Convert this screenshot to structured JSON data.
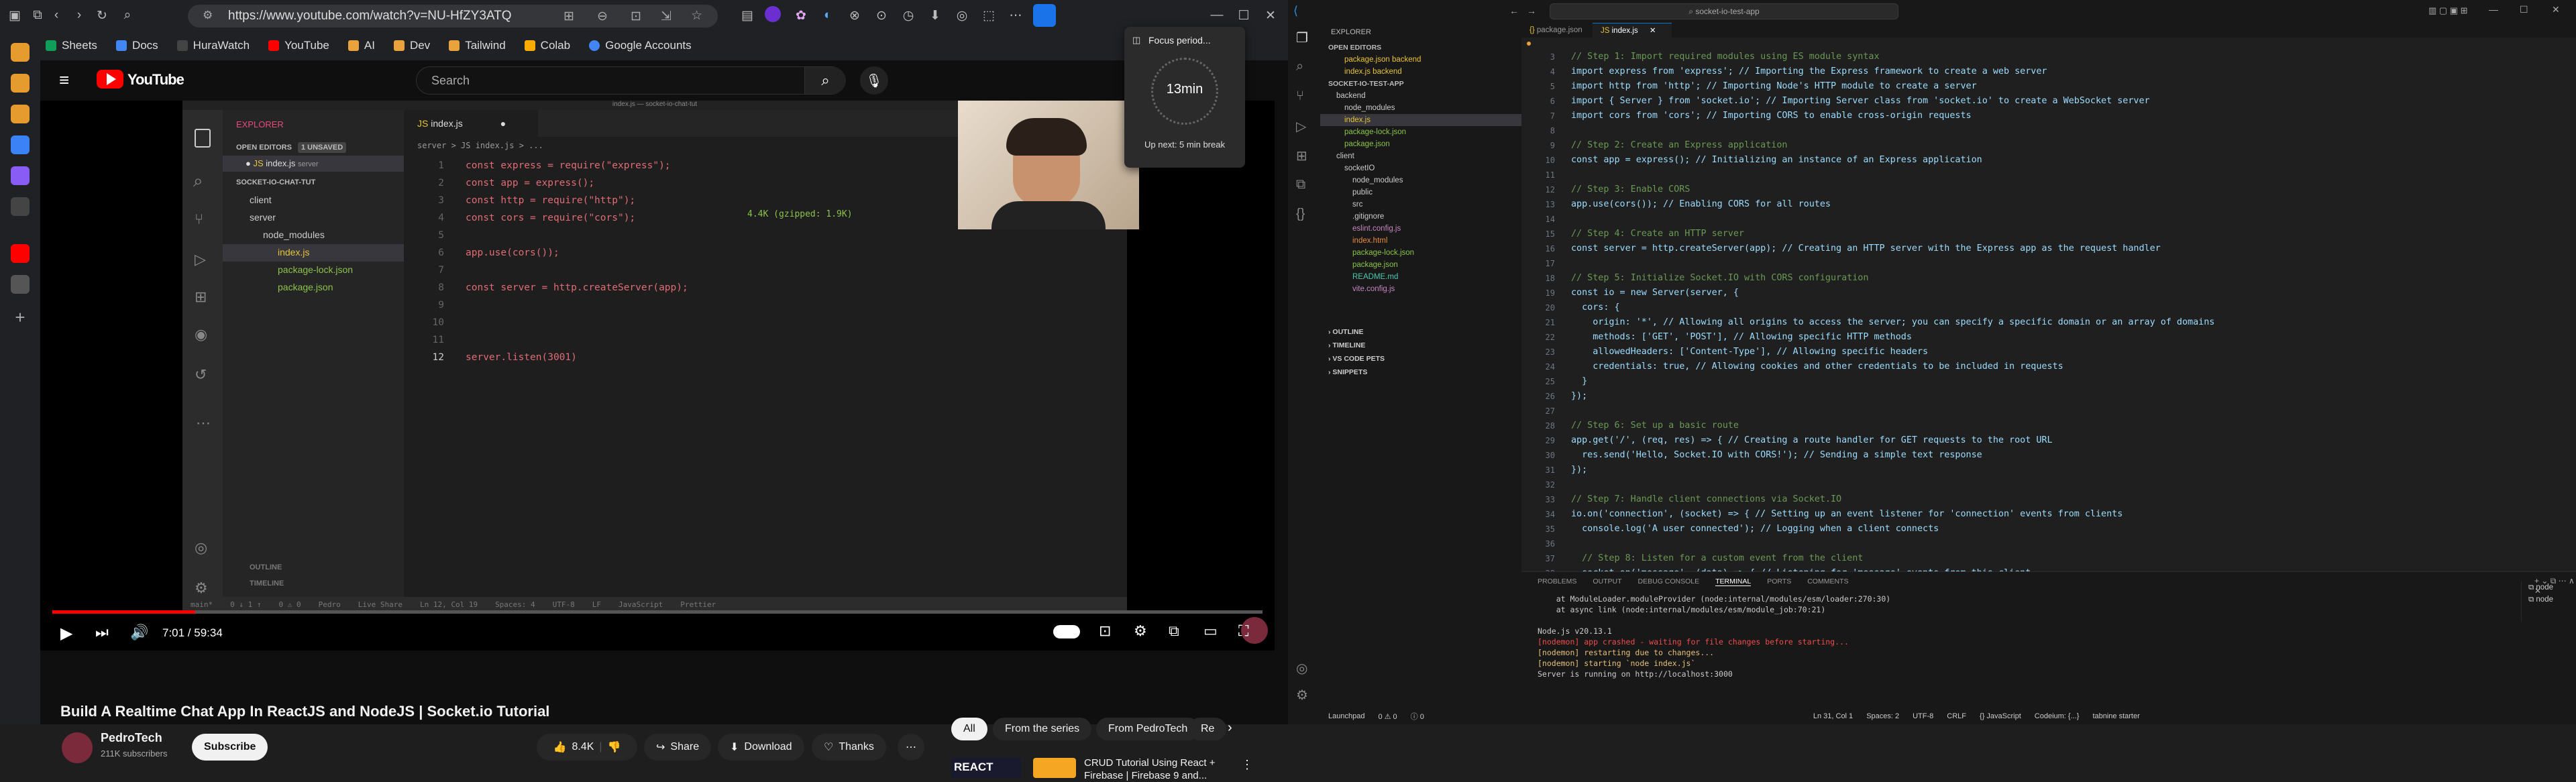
{
  "browser": {
    "url": "https://www.youtube.com/watch?v=NU-HfZY3ATQ",
    "bookmarks": [
      "Sheets",
      "Docs",
      "HuraWatch",
      "YouTube",
      "AI",
      "Dev",
      "Tailwind",
      "Colab",
      "Google Accounts"
    ]
  },
  "focus": {
    "title": "Focus period...",
    "minutes": "13min",
    "next": "Up next: 5 min break"
  },
  "youtube": {
    "search_placeholder": "Search",
    "time": "7:01 / 59:34",
    "progress": 0.1178,
    "title": "Build A Realtime Chat App In ReactJS and NodeJS | Socket.io Tutorial",
    "channel": "PedroTech",
    "subs": "211K subscribers",
    "subscribe": "Subscribe",
    "likes": "8.4K",
    "share": "Share",
    "download": "Download",
    "thanks": "Thanks",
    "chips": [
      "All",
      "From the series",
      "From PedroTech",
      "Re"
    ],
    "rec_title": "CRUD Tutorial Using React + Firebase | Firebase 9 and...",
    "rec_thumb": "REACT"
  },
  "video": {
    "tab": "index.js",
    "explorer": "EXPLORER",
    "open_editors": "OPEN EDITORS",
    "unsaved": "1 UNSAVED",
    "open_file": "index.js",
    "open_file_dir": "server",
    "project": "SOCKET-IO-CHAT-TUT",
    "tree": [
      "client",
      "server",
      "node_modules",
      "index.js",
      "package-lock.json",
      "package.json"
    ],
    "breadcrumb": "server > JS index.js > ...",
    "outline": "OUTLINE",
    "timeline": "TIMELINE",
    "code": [
      "const express = require(\"express\");",
      "const app = express();",
      "const http = require(\"http\");",
      "const cors = require(\"cors\");",
      "",
      "app.use(cors());",
      "",
      "const server = http.createServer(app);",
      "",
      "",
      "",
      "server.listen(3001)"
    ],
    "size_hint": "4.4K (gzipped: 1.9K)",
    "status": [
      "main*",
      "0 ↓ 1 ↑",
      "0 ⚠ 0",
      "Pedro",
      "Live Share",
      "Ln 12, Col 19",
      "Spaces: 4",
      "UTF-8",
      "LF",
      "JavaScript",
      "Prettier"
    ]
  },
  "vscode": {
    "title": "socket-io-test-app",
    "tabs": [
      "package.json",
      "index.js"
    ],
    "explorer": "EXPLORER",
    "tree": [
      "OPEN EDITORS",
      "package.json backend",
      "index.js backend",
      "SOCKET-IO-TEST-APP",
      "backend",
      "node_modules",
      "index.js",
      "package-lock.json",
      "package.json",
      "client",
      "socketIO",
      "node_modules",
      "public",
      "src",
      ".gitignore",
      "eslint.config.js",
      "index.html",
      "package-lock.json",
      "package.json",
      "README.md",
      "vite.config.js"
    ],
    "code": [
      "// Step 1: Import required modules using ES module syntax",
      "import express from 'express'; // Importing the Express framework to create a web server",
      "import http from 'http'; // Importing Node's HTTP module to create a server",
      "import { Server } from 'socket.io'; // Importing Server class from 'socket.io' to create a WebSocket server",
      "import cors from 'cors'; // Importing CORS to enable cross-origin requests",
      "",
      "// Step 2: Create an Express application",
      "const app = express(); // Initializing an instance of an Express application",
      "",
      "// Step 3: Enable CORS",
      "app.use(cors()); // Enabling CORS for all routes",
      "",
      "// Step 4: Create an HTTP server",
      "const server = http.createServer(app); // Creating an HTTP server with the Express app as the request handler",
      "",
      "// Step 5: Initialize Socket.IO with CORS configuration",
      "const io = new Server(server, {",
      "  cors: {",
      "    origin: '*', // Allowing all origins to access the server; you can specify a specific domain or an array of domains",
      "    methods: ['GET', 'POST'], // Allowing specific HTTP methods",
      "    allowedHeaders: ['Content-Type'], // Allowing specific headers",
      "    credentials: true, // Allowing cookies and other credentials to be included in requests",
      "  }",
      "});",
      "",
      "// Step 6: Set up a basic route",
      "app.get('/', (req, res) => { // Creating a route handler for GET requests to the root URL",
      "  res.send('Hello, Socket.IO with CORS!'); // Sending a simple text response",
      "});",
      "",
      "// Step 7: Handle client connections via Socket.IO",
      "io.on('connection', (socket) => { // Setting up an event listener for 'connection' events from clients",
      "  console.log('A user connected'); // Logging when a client connects",
      "",
      "  // Step 8: Listen for a custom event from the client",
      "  socket.on('message', (data) => { // Listening for 'message' events from this client"
    ],
    "panel_tabs": [
      "PROBLEMS",
      "OUTPUT",
      "DEBUG CONSOLE",
      "TERMINAL",
      "PORTS",
      "COMMENTS"
    ],
    "terminal": [
      "    at ModuleLoader.moduleProvider (node:internal/modules/esm/loader:270:30)",
      "    at async link (node:internal/modules/esm/module_job:70:21)",
      "",
      "Node.js v20.13.1",
      "[nodemon] app crashed - waiting for file changes before starting...",
      "[nodemon] restarting due to changes...",
      "[nodemon] starting `node index.js`",
      "Server is running on http://localhost:3000"
    ],
    "term_list": [
      "node",
      "node"
    ],
    "outline": "OUTLINE",
    "timeline": "TIMELINE",
    "vscode_pets": "VS CODE PETS",
    "snippets": "SNIPPETS",
    "status": [
      "Launchpad",
      "0 ⚠ 0",
      "ⓘ 0",
      "Ln 31, Col 1",
      "Spaces: 2",
      "UTF-8",
      "CRLF",
      "{} JavaScript",
      "Codeium: {...}",
      "tabnine starter"
    ]
  }
}
